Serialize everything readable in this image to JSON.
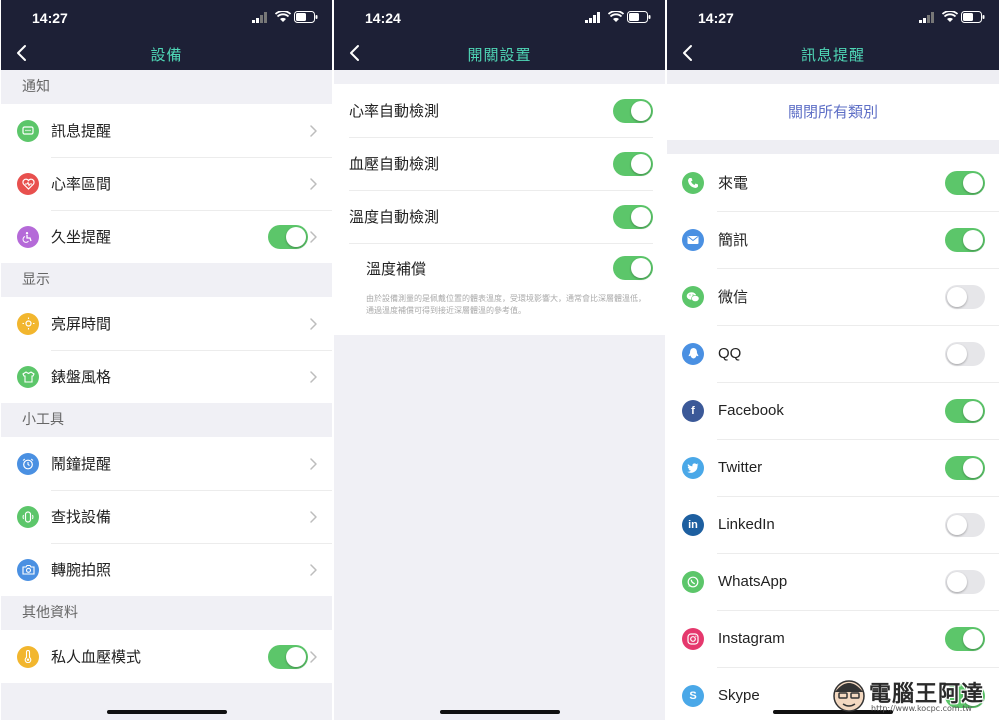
{
  "panel1": {
    "status_time": "14:27",
    "title": "設備",
    "sections": [
      {
        "header": "通知",
        "items": [
          {
            "label": "訊息提醒",
            "icon": "message-icon",
            "color": "#5cc66a",
            "toggle": null
          },
          {
            "label": "心率區間",
            "icon": "heart-rate-icon",
            "color": "#e8504e",
            "toggle": null
          },
          {
            "label": "久坐提醒",
            "icon": "sedentary-icon",
            "color": "#b56ad8",
            "toggle": "on"
          }
        ]
      },
      {
        "header": "显示",
        "items": [
          {
            "label": "亮屏時間",
            "icon": "brightness-icon",
            "color": "#f2b62e",
            "toggle": null
          },
          {
            "label": "錶盤風格",
            "icon": "watchface-icon",
            "color": "#5cc66a",
            "toggle": null
          }
        ]
      },
      {
        "header": "小工具",
        "items": [
          {
            "label": "鬧鐘提醒",
            "icon": "alarm-icon",
            "color": "#4a90e2",
            "toggle": null
          },
          {
            "label": "查找設備",
            "icon": "find-device-icon",
            "color": "#5cc66a",
            "toggle": null
          },
          {
            "label": "轉腕拍照",
            "icon": "camera-icon",
            "color": "#4a90e2",
            "toggle": null
          }
        ]
      },
      {
        "header": "其他資料",
        "items": [
          {
            "label": "私人血壓模式",
            "icon": "thermometer-icon",
            "color": "#f2b62e",
            "toggle": "on"
          }
        ]
      }
    ]
  },
  "panel2": {
    "status_time": "14:24",
    "title": "開關設置",
    "items": [
      {
        "label": "心率自動檢測",
        "toggle": "on"
      },
      {
        "label": "血壓自動檢測",
        "toggle": "on"
      },
      {
        "label": "溫度自動檢測",
        "toggle": "on"
      }
    ],
    "sub_item": {
      "label": "溫度補償",
      "toggle": "on"
    },
    "note": "由於設備測量的是佩戴位置的體表溫度，受環境影響大，通常會比深層體溫低，通過溫度補償可得到接近深層體溫的參考值。"
  },
  "panel3": {
    "status_time": "14:27",
    "title": "訊息提醒",
    "close_all": "關閉所有類別",
    "items": [
      {
        "label": "來電",
        "icon": "phone-icon",
        "color": "#5cc66a",
        "glyph": "",
        "toggle": "on"
      },
      {
        "label": "簡訊",
        "icon": "mail-icon",
        "color": "#4a90e2",
        "glyph": "",
        "toggle": "on"
      },
      {
        "label": "微信",
        "icon": "wechat-icon",
        "color": "#5cc66a",
        "glyph": "",
        "toggle": "off"
      },
      {
        "label": "QQ",
        "icon": "qq-icon",
        "color": "#4a90e2",
        "glyph": "",
        "toggle": "off"
      },
      {
        "label": "Facebook",
        "icon": "facebook-icon",
        "color": "#3b5998",
        "glyph": "f",
        "toggle": "on"
      },
      {
        "label": "Twitter",
        "icon": "twitter-icon",
        "color": "#4aa8e8",
        "glyph": "",
        "toggle": "on"
      },
      {
        "label": "LinkedIn",
        "icon": "linkedin-icon",
        "color": "#1d5fa0",
        "glyph": "in",
        "toggle": "off"
      },
      {
        "label": "WhatsApp",
        "icon": "whatsapp-icon",
        "color": "#5cc66a",
        "glyph": "",
        "toggle": "off"
      },
      {
        "label": "Instagram",
        "icon": "instagram-icon",
        "color": "#e5386d",
        "glyph": "",
        "toggle": "on"
      },
      {
        "label": "Skype",
        "icon": "skype-icon",
        "color": "#4aa8e8",
        "glyph": "S",
        "toggle": "on"
      }
    ]
  },
  "watermark": {
    "text": "電腦王阿達",
    "url": "http://www.kocpc.com.tw"
  }
}
